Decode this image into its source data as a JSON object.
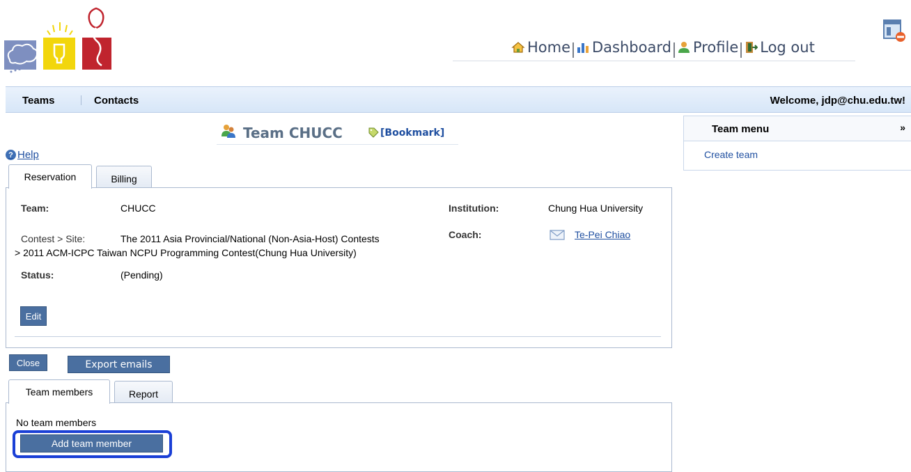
{
  "header": {
    "nav": [
      {
        "label": "Home",
        "icon": "home-icon"
      },
      {
        "label": "Dashboard",
        "icon": "chart-icon"
      },
      {
        "label": "Profile",
        "icon": "user-icon"
      },
      {
        "label": "Log out",
        "icon": "exit-icon"
      }
    ]
  },
  "menubar": {
    "teams": "Teams",
    "contacts": "Contacts",
    "welcome": "Welcome, jdp@chu.edu.tw!"
  },
  "team_menu": {
    "title": "Team menu",
    "items": [
      "Create team"
    ]
  },
  "page": {
    "title": "Team CHUCC",
    "bookmark": "[Bookmark]",
    "help": "Help"
  },
  "top_tabs": [
    "Reservation",
    "Billing"
  ],
  "details": {
    "team_label": "Team:",
    "team_value": "CHUCC",
    "contest_label": "Contest > Site:",
    "contest_value_line1": "The 2011 Asia Provincial/National (Non-Asia-Host) Contests",
    "contest_value_line2": "> 2011 ACM-ICPC Taiwan NCPU Programming Contest(Chung Hua University)",
    "status_label": "Status:",
    "status_value": "(Pending)",
    "institution_label": "Institution:",
    "institution_value": "Chung Hua University",
    "coach_label": "Coach:",
    "coach_value": "Te-Pei Chiao",
    "edit_button": "Edit"
  },
  "actions": {
    "close": "Close",
    "export": "Export emails"
  },
  "bottom_tabs": [
    "Team members",
    "Report"
  ],
  "members": {
    "empty_text": "No team members",
    "add_button": "Add team member"
  },
  "colors": {
    "accent": "#4a6fa0",
    "link": "#1f4fa0",
    "menubar": "#d7e6f8",
    "focus": "#1a3fd6"
  }
}
